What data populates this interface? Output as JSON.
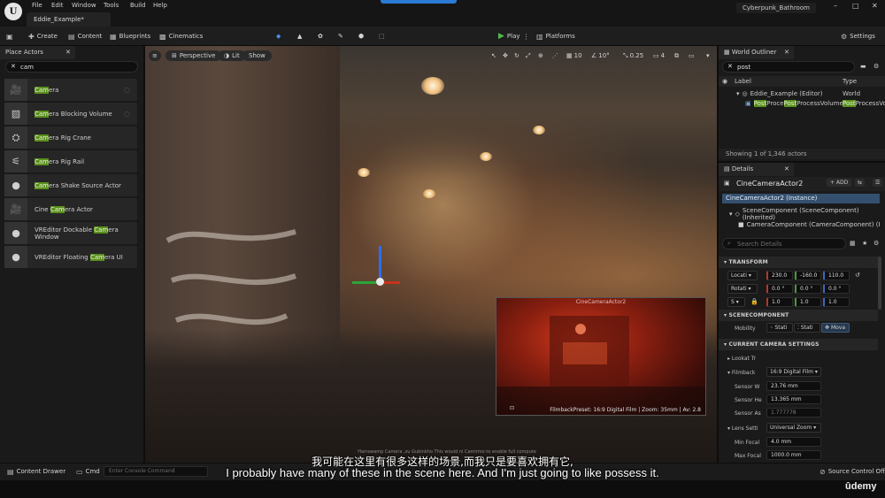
{
  "window": {
    "menu": [
      "File",
      "Edit",
      "Window",
      "Tools",
      "Build",
      "Help"
    ],
    "doc_tab": "Eddie_Example*",
    "project": "Cyberpunk_Bathroom",
    "controls": [
      "–",
      "□",
      "✕"
    ]
  },
  "toolbar": {
    "create": "Create",
    "content": "Content",
    "blueprints": "Blueprints",
    "cinematics": "Cinematics",
    "play": "Play",
    "platforms": "Platforms",
    "settings": "Settings"
  },
  "place_actors": {
    "tab": "Place Actors",
    "search_value": "cam",
    "items": [
      {
        "pre": "",
        "hl": "Cam",
        "post": "era"
      },
      {
        "pre": "",
        "hl": "Cam",
        "post": "era Blocking Volume"
      },
      {
        "pre": "",
        "hl": "Cam",
        "post": "era Rig Crane"
      },
      {
        "pre": "",
        "hl": "Cam",
        "post": "era Rig Rail"
      },
      {
        "pre": "",
        "hl": "Cam",
        "post": "era Shake Source Actor"
      },
      {
        "pre": "Cine ",
        "hl": "Cam",
        "post": "era Actor"
      },
      {
        "pre": "VREditor Dockable ",
        "hl": "Cam",
        "post": "era Window"
      },
      {
        "pre": "VREditor Floating ",
        "hl": "Cam",
        "post": "era UI"
      }
    ]
  },
  "viewport": {
    "perspective": "Perspective",
    "lit": "Lit",
    "show": "Show",
    "grid": "10",
    "angle": "10°",
    "scale": "0.25",
    "camera_speed": "4",
    "pip_title": "CineCameraActor2",
    "pip_footer": "FilmbackPreset: 16:9 Digital Film | Zoom: 35mm | Av: 2.8",
    "graffiti": "РНОМНИТЕ\nЛЕТИ\nМАП"
  },
  "outliner": {
    "tab": "World Outliner",
    "search_value": "post",
    "col_label": "Label",
    "col_type": "Type",
    "world_label": "Eddie_Example (Editor)",
    "world_type": "World",
    "actor_hl1": "Post",
    "actor_mid": "Proce",
    "actor_hl2": "Post",
    "actor_rest": "ProcessVolume",
    "actor_type_hl": "Post",
    "actor_type_rest": "ProcessVo",
    "status": "Showing 1 of 1,346 actors"
  },
  "details": {
    "tab": "Details",
    "actor_name": "CineCameraActor2",
    "add_label": "+ ADD",
    "instance": "CineCameraActor2 (Instance)",
    "scene_component": "SceneComponent (SceneComponent) (Inherited)",
    "camera_component": "CameraComponent (CameraComponent) (Inherit",
    "search_placeholder": "Search Details",
    "transform_header": "TRANSFORM",
    "location_label": "Locati",
    "location": [
      "230.0",
      "-160.0",
      "110.0"
    ],
    "rotation_label": "Rotati",
    "rotation": [
      "0.0 °",
      "0.0 °",
      "0.0 °"
    ],
    "scale_label": "S",
    "scale": [
      "1.0",
      "1.0",
      "1.0"
    ],
    "scenecomponent_header": "SCENECOMPONENT",
    "mobility_label": "Mobility",
    "mobility_options": [
      "Stati",
      "Stati",
      "Mova"
    ],
    "camera_settings_header": "CURRENT CAMERA SETTINGS",
    "lookat_label": "Lookat Tr",
    "filmback_label": "Filmback",
    "filmback_value": "16:9 Digital Film",
    "sensor_w_label": "Sensor W",
    "sensor_w": "23.76 mm",
    "sensor_h_label": "Sensor He",
    "sensor_h": "13.365 mm",
    "sensor_a_label": "Sensor As",
    "sensor_a": "1.777778",
    "lens_label": "Lens Setti",
    "lens_value": "Universal Zoom",
    "min_focal_label": "Min Focal",
    "min_focal": "4.0 mm",
    "max_focal_label": "Max Focal",
    "max_focal": "1000.0 mm"
  },
  "bottom": {
    "content_drawer": "Content Drawer",
    "cmd": "Cmd",
    "console_placeholder": "Enter Console Command",
    "source_control": "Source Control Off"
  },
  "subtitles": {
    "faint": "Harrawamp Camera ,zu Gubinkho This would ni Camirmo to enable full compute",
    "cn": "我可能在这里有很多这样的场景,而我只是要喜欢拥有它,",
    "en": "I probably have many of these in the scene here. And I'm just going to like possess it.",
    "brand": "ûdemy"
  },
  "colors": {
    "highlight": "#5a8f1e",
    "play": "#53b84a",
    "selection": "#34506e",
    "accent": "#2b7bd6"
  }
}
